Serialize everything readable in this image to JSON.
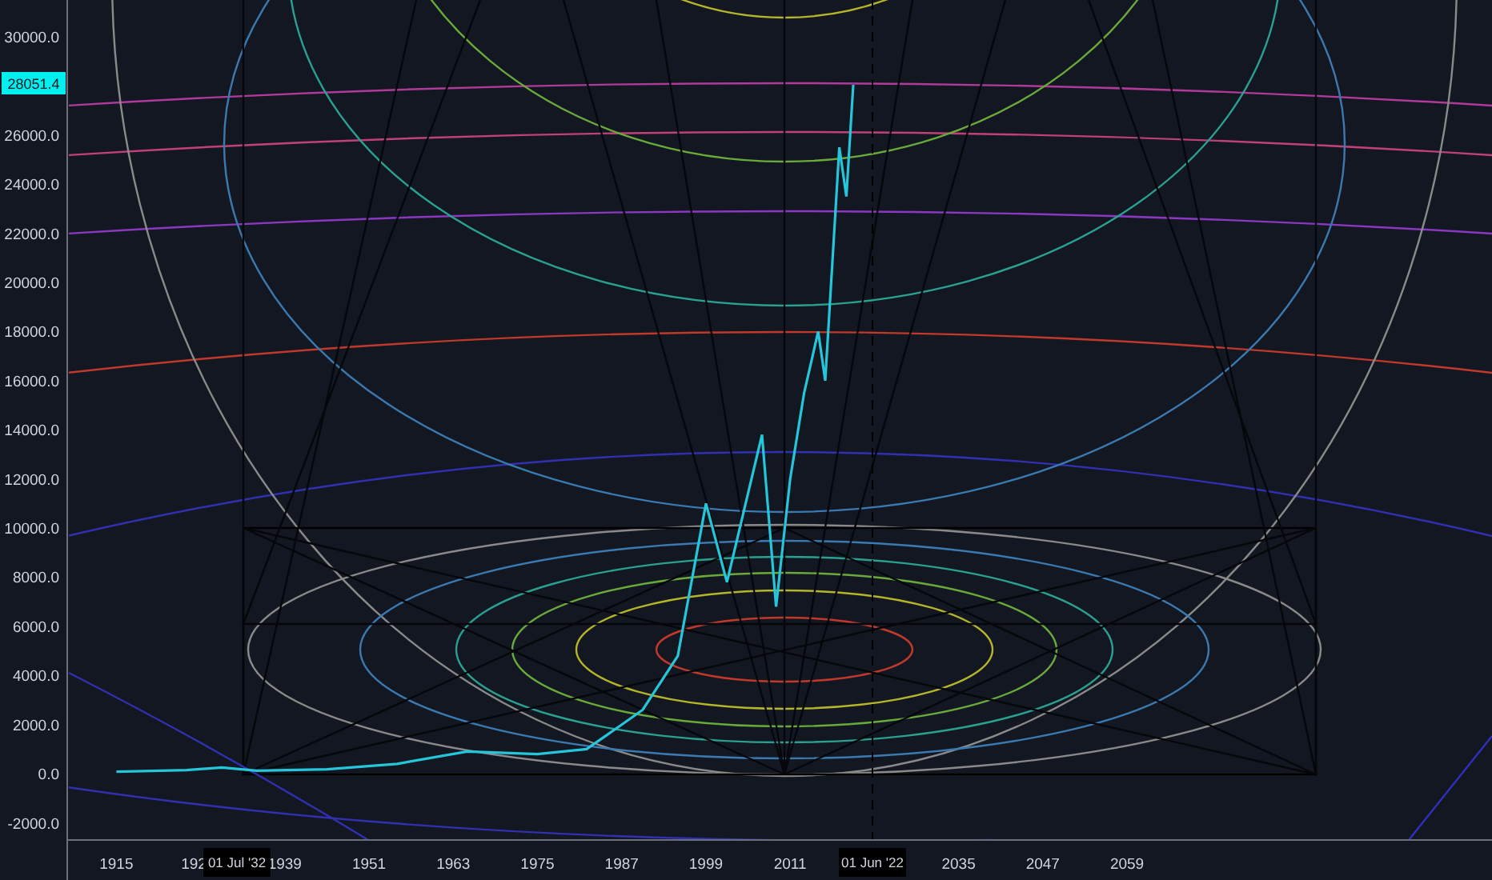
{
  "chart": {
    "chart_data": {
      "type": "line",
      "x": [
        1915,
        1925,
        1930,
        1935,
        1945,
        1955,
        1965,
        1975,
        1982,
        1987,
        1990,
        1995,
        1999,
        2002,
        2007,
        2009,
        2011,
        2013,
        2015,
        2016,
        2018,
        2019,
        2020
      ],
      "series": [
        {
          "color": "#26c6da",
          "values": [
            80,
            150,
            250,
            120,
            180,
            400,
            900,
            800,
            1000,
            2000,
            2600,
            4800,
            11000,
            7800,
            13800,
            6800,
            12000,
            15500,
            18000,
            16000,
            25500,
            23500,
            28050
          ]
        }
      ],
      "xlim": [
        1908,
        2111
      ],
      "ylim": [
        -2700,
        31500
      ],
      "yticks": [
        {
          "value": -2000,
          "label": "-2000.0"
        },
        {
          "value": 0,
          "label": "0.0"
        },
        {
          "value": 2000,
          "label": "2000.0"
        },
        {
          "value": 4000,
          "label": "4000.0"
        },
        {
          "value": 6000,
          "label": "6000.0"
        },
        {
          "value": 8000,
          "label": "8000.0"
        },
        {
          "value": 10000,
          "label": "10000.0"
        },
        {
          "value": 12000,
          "label": "12000.0"
        },
        {
          "value": 14000,
          "label": "14000.0"
        },
        {
          "value": 16000,
          "label": "16000.0"
        },
        {
          "value": 18000,
          "label": "18000.0"
        },
        {
          "value": 20000,
          "label": "20000.0"
        },
        {
          "value": 22000,
          "label": "22000.0"
        },
        {
          "value": 24000,
          "label": "24000.0"
        },
        {
          "value": 26000,
          "label": "26000.0"
        },
        {
          "value": 30000,
          "label": "30000.0"
        }
      ],
      "xticks": [
        {
          "value": 1915,
          "label": "1915"
        },
        {
          "value": 1939,
          "label": "1939"
        },
        {
          "value": 1951,
          "label": "1951"
        },
        {
          "value": 1963,
          "label": "1963"
        },
        {
          "value": 1975,
          "label": "1975"
        },
        {
          "value": 1987,
          "label": "1987"
        },
        {
          "value": 1999,
          "label": "1999"
        },
        {
          "value": 2011,
          "label": "2011"
        },
        {
          "value": 2035,
          "label": "2035"
        },
        {
          "value": 2047,
          "label": "2047"
        },
        {
          "value": 2059,
          "label": "2059"
        }
      ]
    },
    "cut_tick_label": "192",
    "last_price": "28051.4",
    "date_markers": [
      {
        "label": "01 Jul '32",
        "kind": "plain"
      },
      {
        "label": "01 Jun '22",
        "kind": "dashed"
      }
    ]
  }
}
